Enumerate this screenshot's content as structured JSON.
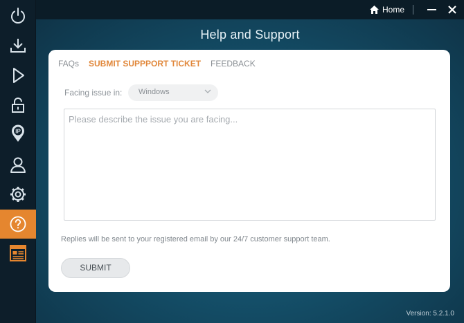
{
  "titlebar": {
    "home_label": "Home"
  },
  "sidebar": {
    "items": [
      {
        "icon": "power-icon"
      },
      {
        "icon": "download-icon"
      },
      {
        "icon": "play-icon"
      },
      {
        "icon": "lock-icon"
      },
      {
        "icon": "ip-location-icon"
      },
      {
        "icon": "user-icon"
      },
      {
        "icon": "gear-icon"
      },
      {
        "icon": "help-icon",
        "active": true
      },
      {
        "icon": "news-icon"
      }
    ],
    "accent_color": "#e5862f"
  },
  "page": {
    "title": "Help and Support"
  },
  "tabs": [
    {
      "label": "FAQs"
    },
    {
      "label": "SUBMIT SUPPPORT TICKET",
      "active": true
    },
    {
      "label": "FEEDBACK"
    }
  ],
  "form": {
    "facing_label": "Facing issue in:",
    "os_selected": "Windows",
    "description_placeholder": "Please describe the issue you are facing...",
    "note": "Replies will be sent to your registered email by our 24/7 customer support team.",
    "submit_label": "SUBMIT"
  },
  "footer": {
    "version": "Version:  5.2.1.0"
  }
}
